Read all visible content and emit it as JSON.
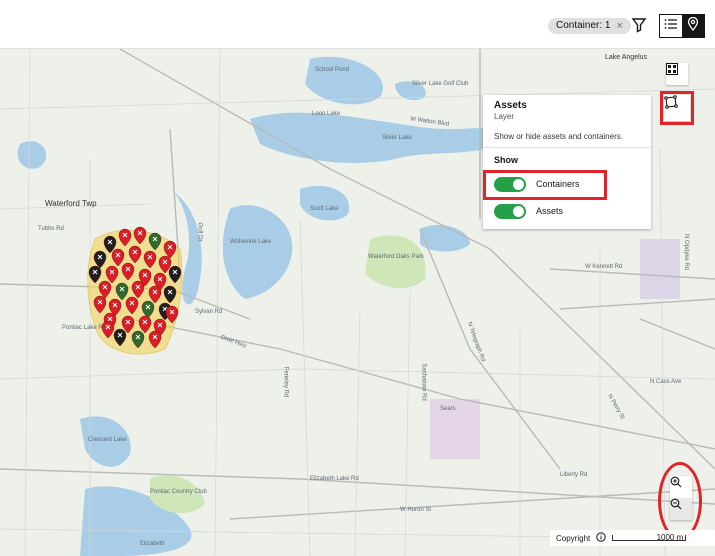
{
  "toolbar": {
    "filter_chip_label": "Container: 1",
    "filter_chip_clear": "×",
    "view_list_icon": "list-icon",
    "view_map_icon": "location-pin-icon"
  },
  "map": {
    "place_labels": {
      "lake_angelus": "Lake Angelus",
      "waterford_twp": "Waterford Twp",
      "loon_lake": "Loon Lake",
      "silver_lake": "Silver Lake",
      "scott_lake": "Scott Lake",
      "wolverine_lake": "Wolverine Lake",
      "crescent_lake": "Crescent Lake",
      "waterford_oaks": "Waterford Oaks Park",
      "pontiac_cc": "Pontiac Country Club",
      "school_lake": "School Pond",
      "silver_lake_golf": "Silver Lake Golf Club",
      "elizabeth": "Elizabeth",
      "sears": "Sears"
    },
    "road_labels": {
      "tubbs": "Tubbs Rd",
      "pontiac_lake": "Pontiac Lake Rd",
      "dixie": "Dixie Hwy",
      "telegraph": "N Telegraph Rd",
      "elizabeth_lake": "Elizabeth Lake Rd",
      "huron": "W Huron St",
      "walton": "W Walton Blvd",
      "perry": "N Perry St",
      "opdyke": "N Opdyke Rd",
      "liberty": "Liberty Rd",
      "cass": "N Cass Ave",
      "kennett": "W Kennett Rd",
      "sylvan": "Sylvan Rd",
      "feneley": "Feneley Rd",
      "sashabaw": "Sashabaw Rd",
      "golf": "Golf Dr"
    }
  },
  "tools": {
    "basemap_icon": "basemap-gallery-icon",
    "layers_icon": "layer-select-icon",
    "zoom_in_icon": "zoom-in-icon",
    "zoom_out_icon": "zoom-out-icon"
  },
  "layer_panel": {
    "title": "Assets",
    "subtitle": "Layer",
    "description": "Show or hide assets and containers.",
    "show_heading": "Show",
    "toggles": [
      {
        "label": "Containers",
        "on": true
      },
      {
        "label": "Assets",
        "on": true
      }
    ]
  },
  "footer": {
    "copyright": "Copyright",
    "info_icon": "info-icon",
    "scale": "1000 m"
  },
  "colors": {
    "accent_green": "#24a148",
    "annotation_red": "#e0242a",
    "marker_red": "#da1e28",
    "water": "#a9cde6"
  }
}
